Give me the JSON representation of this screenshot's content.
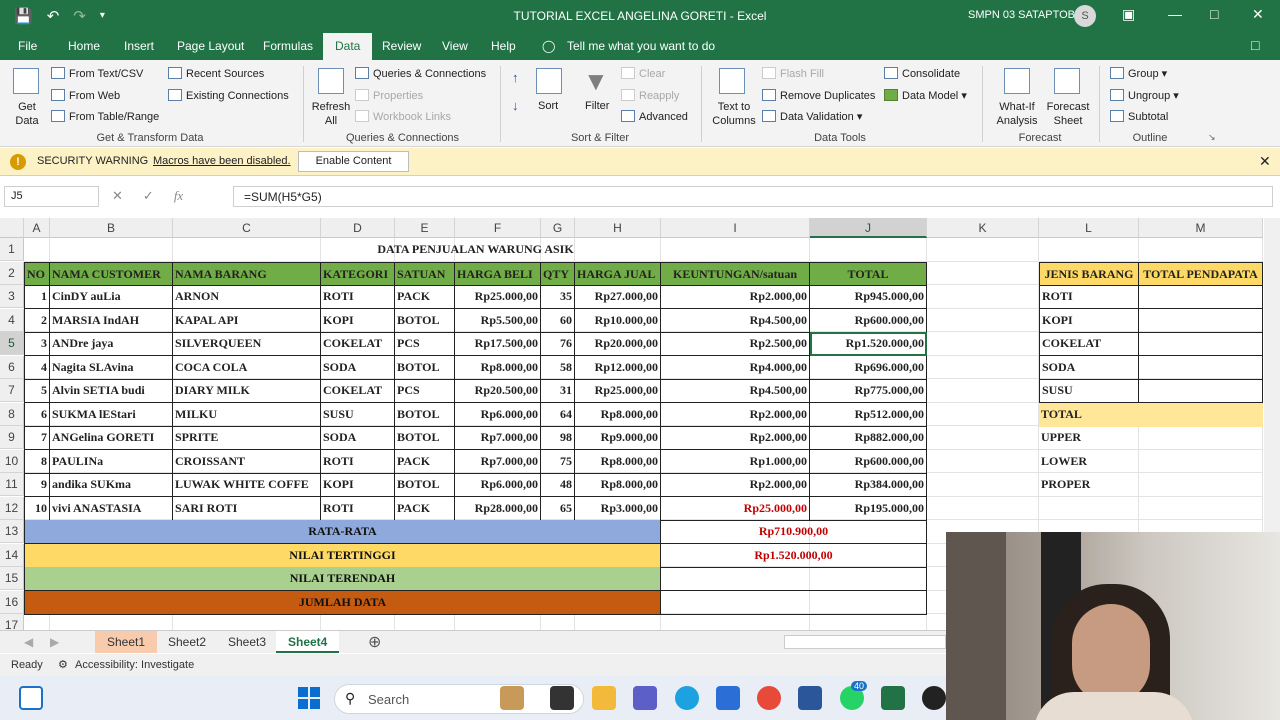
{
  "window": {
    "title": "TUTORIAL EXCEL ANGELINA GORETI  -  Excel",
    "account": "SMPN 03 SATAPTOBA",
    "avatar_initial": "S"
  },
  "menu": {
    "tabs": [
      "File",
      "Home",
      "Insert",
      "Page Layout",
      "Formulas",
      "Data",
      "Review",
      "View",
      "Help"
    ],
    "active": "Data",
    "tell_me": "Tell me what you want to do"
  },
  "ribbon": {
    "get_data": "Get Data",
    "from_text_csv": "From Text/CSV",
    "from_web": "From Web",
    "from_table_range": "From Table/Range",
    "recent_sources": "Recent Sources",
    "existing_connections": "Existing Connections",
    "group_get_transform": "Get & Transform Data",
    "refresh_all": "Refresh All",
    "queries_connections": "Queries & Connections",
    "properties": "Properties",
    "workbook_links": "Workbook Links",
    "group_queries": "Queries & Connections",
    "sort": "Sort",
    "filter": "Filter",
    "clear": "Clear",
    "reapply": "Reapply",
    "advanced": "Advanced",
    "group_sort_filter": "Sort & Filter",
    "text_to_columns": "Text to Columns",
    "flash_fill": "Flash Fill",
    "remove_duplicates": "Remove Duplicates",
    "data_validation": "Data Validation",
    "consolidate": "Consolidate",
    "data_model": "Data Model",
    "group_data_tools": "Data Tools",
    "what_if": "What-If Analysis",
    "forecast_sheet": "Forecast Sheet",
    "group_forecast": "Forecast",
    "group": "Group",
    "ungroup": "Ungroup",
    "subtotal": "Subtotal",
    "group_outline": "Outline"
  },
  "security": {
    "label": "SECURITY WARNING",
    "message": "Macros have been disabled.",
    "button": "Enable Content"
  },
  "formula_bar": {
    "name_box": "J5",
    "formula": "=SUM(H5*G5)"
  },
  "sheet": {
    "columns": [
      "A",
      "B",
      "C",
      "D",
      "E",
      "F",
      "G",
      "H",
      "I",
      "J",
      "K",
      "L",
      "M"
    ],
    "selected_column": "J",
    "selected_row": "5",
    "row_numbers": [
      "1",
      "2",
      "3",
      "4",
      "5",
      "6",
      "7",
      "8",
      "9",
      "10",
      "11",
      "12",
      "13",
      "14",
      "15",
      "16",
      "17"
    ],
    "title": "DATA PENJUALAN WARUNG ASIK",
    "headers": [
      "NO",
      "NAMA CUSTOMER",
      "NAMA BARANG",
      "KATEGORI",
      "SATUAN",
      "HARGA BELI",
      "QTY",
      "HARGA JUAL",
      "KEUNTUNGAN/satuan",
      "TOTAL"
    ],
    "rows": [
      [
        "1",
        "CinDY auLia",
        "ARNON",
        "ROTI",
        "PACK",
        "Rp25.000,00",
        "35",
        "Rp27.000,00",
        "Rp2.000,00",
        "Rp945.000,00"
      ],
      [
        "2",
        "MARSIA IndAH",
        "KAPAL API",
        "KOPI",
        "BOTOL",
        "Rp5.500,00",
        "60",
        "Rp10.000,00",
        "Rp4.500,00",
        "Rp600.000,00"
      ],
      [
        "3",
        "ANDre jaya",
        "SILVERQUEEN",
        "COKELAT",
        "PCS",
        "Rp17.500,00",
        "76",
        "Rp20.000,00",
        "Rp2.500,00",
        "Rp1.520.000,00"
      ],
      [
        "4",
        "Nagita SLAvina",
        "COCA COLA",
        "SODA",
        "BOTOL",
        "Rp8.000,00",
        "58",
        "Rp12.000,00",
        "Rp4.000,00",
        "Rp696.000,00"
      ],
      [
        "5",
        "Alvin SETIA budi",
        "DIARY MILK",
        "COKELAT",
        "PCS",
        "Rp20.500,00",
        "31",
        "Rp25.000,00",
        "Rp4.500,00",
        "Rp775.000,00"
      ],
      [
        "6",
        "SUKMA lEStari",
        "MILKU",
        "SUSU",
        "BOTOL",
        "Rp6.000,00",
        "64",
        "Rp8.000,00",
        "Rp2.000,00",
        "Rp512.000,00"
      ],
      [
        "7",
        "ANGelina GORETI",
        "SPRITE",
        "SODA",
        "BOTOL",
        "Rp7.000,00",
        "98",
        "Rp9.000,00",
        "Rp2.000,00",
        "Rp882.000,00"
      ],
      [
        "8",
        "PAULINa",
        "CROISSANT",
        "ROTI",
        "PACK",
        "Rp7.000,00",
        "75",
        "Rp8.000,00",
        "Rp1.000,00",
        "Rp600.000,00"
      ],
      [
        "9",
        "andika SUKma",
        "LUWAK WHITE COFFE",
        "KOPI",
        "BOTOL",
        "Rp6.000,00",
        "48",
        "Rp8.000,00",
        "Rp2.000,00",
        "Rp384.000,00"
      ],
      [
        "10",
        "vivi ANASTASIA",
        "SARI ROTI",
        "ROTI",
        "PACK",
        "Rp28.000,00",
        "65",
        "Rp3.000,00",
        "Rp25.000,00",
        "Rp195.000,00"
      ]
    ],
    "summary": [
      {
        "label": "RATA-RATA",
        "value": "Rp710.900,00",
        "color": "#8ea9db"
      },
      {
        "label": "NILAI TERTINGGI",
        "value": "Rp1.520.000,00",
        "color": "#ffd966"
      },
      {
        "label": "NILAI TERENDAH",
        "value": "",
        "color": "#a9d08e"
      },
      {
        "label": "JUMLAH DATA",
        "value": "",
        "color": "#c55a11"
      }
    ],
    "side_table": {
      "headers": [
        "JENIS BARANG",
        "TOTAL PENDAPATA"
      ],
      "items": [
        "ROTI",
        "KOPI",
        "COKELAT",
        "SODA",
        "SUSU"
      ],
      "total_label": "TOTAL",
      "extra": [
        "UPPER",
        "LOWER",
        "PROPER"
      ]
    }
  },
  "sheet_tabs": [
    "Sheet1",
    "Sheet2",
    "Sheet3",
    "Sheet4"
  ],
  "active_sheet": "Sheet4",
  "status": {
    "ready": "Ready",
    "accessibility": "Accessibility: Investigate"
  },
  "taskbar": {
    "search_placeholder": "Search",
    "badge": "40"
  },
  "colors": {
    "excel_green": "#217346",
    "header_green": "#70ad47",
    "side_header_yellow": "#ffd966",
    "total_row_yellow": "#ffe699",
    "value_red": "#c00000"
  }
}
